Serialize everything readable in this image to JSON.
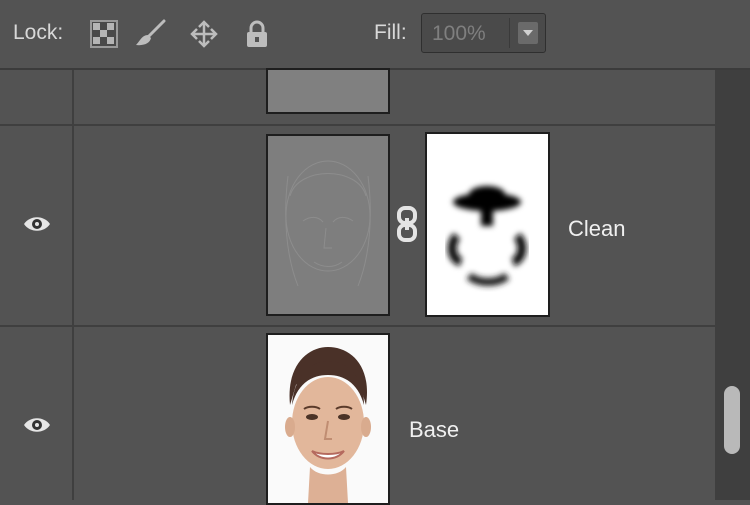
{
  "toolbar": {
    "lock_label": "Lock:",
    "icons": [
      "lock-transparent-pixels-icon",
      "lock-image-pixels-icon",
      "lock-position-icon",
      "lock-all-icon"
    ],
    "fill_label": "Fill:",
    "fill_value": "100%"
  },
  "layers": [
    {
      "name": "",
      "visible": false,
      "thumbnail": "gray-layer-thumbnail"
    },
    {
      "name": "Clean",
      "visible": true,
      "thumbnail": "high-pass-layer-thumbnail",
      "mask": "layer-mask-thumbnail",
      "linked": true
    },
    {
      "name": "Base",
      "visible": true,
      "thumbnail": "portrait-photo-thumbnail"
    }
  ],
  "colors": {
    "panel": "#535353",
    "separator": "#3f3f3f",
    "text": "#f0f0f0"
  }
}
